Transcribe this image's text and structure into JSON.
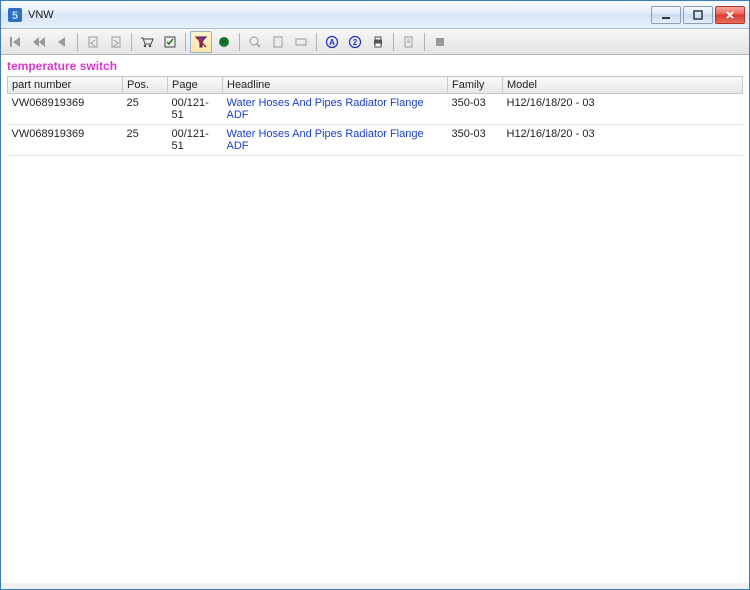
{
  "window": {
    "title": "VNW"
  },
  "search_term": "temperature switch",
  "columns": {
    "part_number": "part number",
    "pos": "Pos.",
    "page": "Page",
    "headline": "Headline",
    "family": "Family",
    "model": "Model"
  },
  "rows": [
    {
      "part_number": "VW068919369",
      "pos": "25",
      "page": "00/121-51",
      "headline": "Water Hoses And Pipes Radiator Flange ADF",
      "family": "350-03",
      "model": "H12/16/18/20 - 03"
    },
    {
      "part_number": "VW068919369",
      "pos": "25",
      "page": "00/121-51",
      "headline": "Water Hoses And Pipes Radiator Flange ADF",
      "family": "350-03",
      "model": "H12/16/18/20 - 03"
    }
  ]
}
